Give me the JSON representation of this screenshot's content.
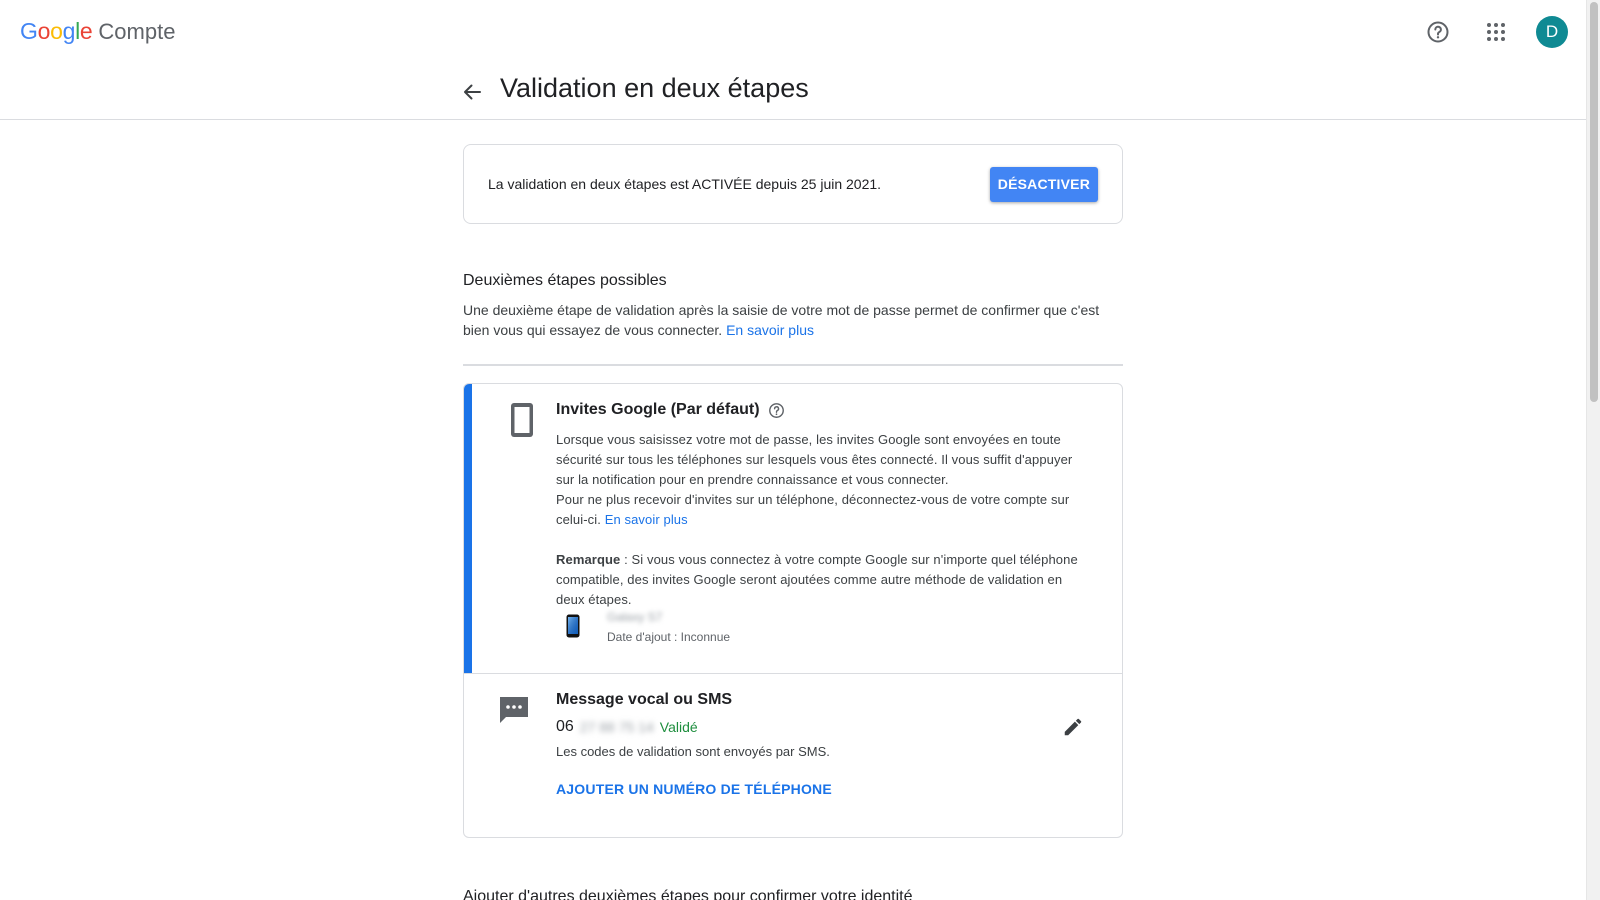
{
  "header": {
    "google_logo_letters": [
      {
        "char": "G",
        "color": "#4285F4"
      },
      {
        "char": "o",
        "color": "#EA4335"
      },
      {
        "char": "o",
        "color": "#FBBC05"
      },
      {
        "char": "g",
        "color": "#4285F4"
      },
      {
        "char": "l",
        "color": "#34A853"
      },
      {
        "char": "e",
        "color": "#EA4335"
      }
    ],
    "product_name": "Compte",
    "avatar_letter": "D",
    "avatar_color": "#0f8a93",
    "icons": [
      "help-icon",
      "apps-grid-icon"
    ]
  },
  "page": {
    "title": "Validation en deux étapes"
  },
  "status": {
    "text": "La validation en deux étapes est ACTIVÉE depuis 25 juin 2021.",
    "disable_button": "DÉSACTIVER"
  },
  "second_steps": {
    "title": "Deuxièmes étapes possibles",
    "description": "Une deuxième étape de validation après la saisie de votre mot de passe permet de confirmer que c'est bien vous qui essayez de vous connecter.",
    "learn_more": "En savoir plus"
  },
  "google_prompts": {
    "title": "Invites Google (Par défaut)",
    "description_1": "Lorsque vous saisissez votre mot de passe, les invites Google sont envoyées en toute sécurité sur tous les téléphones sur lesquels vous êtes connecté. Il vous suffit d'appuyer sur la notification pour en prendre connaissance et vous connecter.",
    "description_2": "Pour ne plus recevoir d'invites sur un téléphone, déconnectez-vous de votre compte sur celui-ci.",
    "learn_more": "En savoir plus",
    "note_label": "Remarque",
    "note_text": " : Si vous vous connectez à votre compte Google sur n'importe quel téléphone compatible, des invites Google seront ajoutées comme autre méthode de validation en deux étapes.",
    "device": {
      "name": "Galaxy S7",
      "date_added": "Date d'ajout : Inconnue"
    },
    "accent_color": "#1a73e8"
  },
  "sms": {
    "title": "Message vocal ou SMS",
    "phone_prefix": "06",
    "phone_hidden": "27 88 75 14",
    "phone_status": "Validé",
    "note": "Les codes de validation sont envoyés par SMS.",
    "add_phone": "AJOUTER UN NUMÉRO DE TÉLÉPHONE"
  },
  "next_section": {
    "title": "Ajouter d'autres deuxièmes étapes pour confirmer votre identité"
  }
}
